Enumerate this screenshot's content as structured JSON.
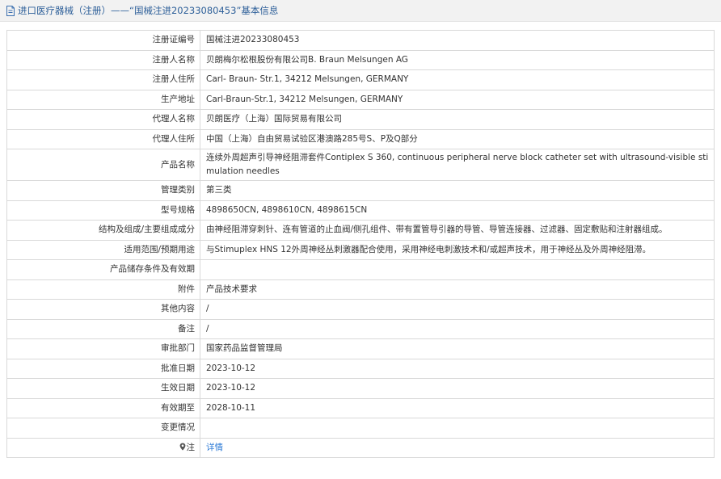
{
  "header": {
    "title": "进口医疗器械（注册）——“国械注进20233080453”基本信息",
    "title_color": "#2d5f99"
  },
  "rows": [
    {
      "label": "注册证编号",
      "value": "国械注进20233080453"
    },
    {
      "label": "注册人名称",
      "value": "贝朗梅尔松根股份有限公司B. Braun Melsungen AG"
    },
    {
      "label": "注册人住所",
      "value": "Carl- Braun- Str.1, 34212 Melsungen, GERMANY"
    },
    {
      "label": "生产地址",
      "value": "Carl-Braun-Str.1, 34212 Melsungen, GERMANY"
    },
    {
      "label": "代理人名称",
      "value": "贝朗医疗（上海）国际贸易有限公司"
    },
    {
      "label": "代理人住所",
      "value": "中国（上海）自由贸易试验区港澳路285号S、P及Q部分"
    },
    {
      "label": "产品名称",
      "value": "连续外周超声引导神经阻滞套件Contiplex S 360, continuous peripheral nerve block catheter set with ultrasound-visible stimulation needles"
    },
    {
      "label": "管理类别",
      "value": "第三类"
    },
    {
      "label": "型号规格",
      "value": "4898650CN, 4898610CN, 4898615CN"
    },
    {
      "label": "结构及组成/主要组成成分",
      "value": "由神经阻滞穿刺针、连有管道的止血阀/侧孔组件、带有置管导引器的导管、导管连接器、过滤器、固定敷贴和注射器组成。"
    },
    {
      "label": "适用范围/预期用途",
      "value": "与Stimuplex HNS 12外周神经丛刺激器配合使用，采用神经电刺激技术和/或超声技术，用于神经丛及外周神经阻滞。"
    },
    {
      "label": "产品储存条件及有效期",
      "value": ""
    },
    {
      "label": "附件",
      "value": "产品技术要求"
    },
    {
      "label": "其他内容",
      "value": "/"
    },
    {
      "label": "备注",
      "value": "/"
    },
    {
      "label": "审批部门",
      "value": "国家药品监督管理局"
    },
    {
      "label": "批准日期",
      "value": "2023-10-12"
    },
    {
      "label": "生效日期",
      "value": "2023-10-12"
    },
    {
      "label": "有效期至",
      "value": "2028-10-11"
    },
    {
      "label": "变更情况",
      "value": ""
    }
  ],
  "note_row": {
    "label": "注",
    "icon": "pin-icon",
    "link_text": "详情",
    "link_color": "#2d7bd6"
  }
}
